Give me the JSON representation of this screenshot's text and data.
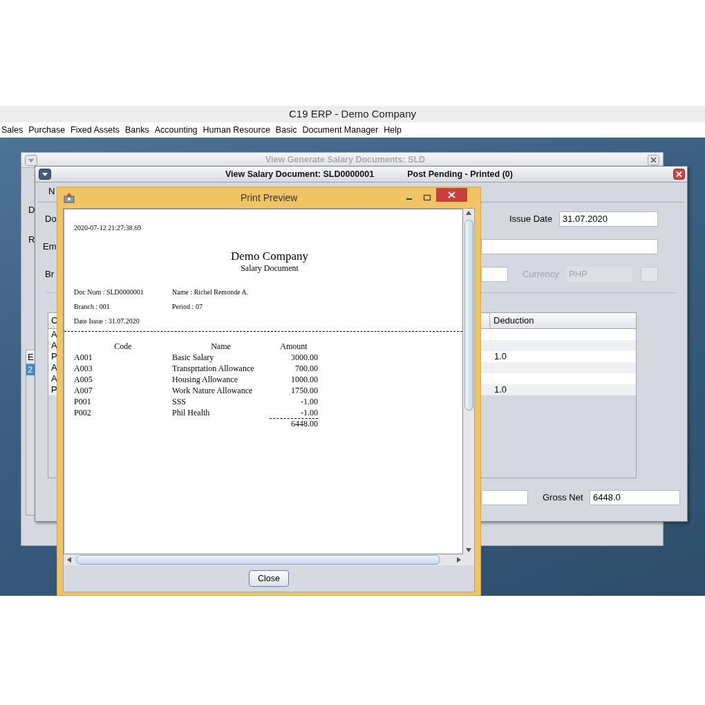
{
  "app": {
    "title": "C19 ERP - Demo Company"
  },
  "menu": [
    "Sales",
    "Purchase",
    "Fixed Assets",
    "Banks",
    "Accounting",
    "Human Resource",
    "Basic",
    "Document Manager",
    "Help"
  ],
  "back_window": {
    "title": "View Generate Salary Documents: SLD",
    "active": false,
    "labels": [
      "D",
      "R"
    ],
    "table": {
      "header": "E",
      "rows": [
        {
          "cell": "2",
          "selected": true
        }
      ]
    }
  },
  "salary_window": {
    "title": "View Salary Document: SLD0000001",
    "status": "Post Pending - Printed (0)",
    "active": true,
    "tab": "N",
    "labels": [
      "Do",
      "Em",
      "Br"
    ],
    "issue_date": {
      "label": "Issue Date",
      "value": "31.07.2020"
    },
    "currency": {
      "label": "Currency",
      "value": "PHP",
      "disabled": true
    },
    "table": {
      "columns": [
        "C",
        "Deduction"
      ],
      "rows": [
        {
          "column_1": "A"
        },
        {
          "column_1": "A"
        },
        {
          "column_1": "P",
          "deduction": "1.0"
        },
        {
          "column_1": "A"
        },
        {
          "column_1": "A"
        },
        {
          "column_1": "P",
          "deduction": "1.0"
        }
      ]
    },
    "gross_net": {
      "label": "Gross Net",
      "value": "6448.0"
    }
  },
  "print_preview": {
    "title": "Print Preview",
    "document": {
      "timestamp": "2020-07-12 21:27:38.69",
      "company": "Demo Company",
      "subtitle": "Salary Document",
      "fields": [
        [
          "Doc Num : SLD0000001",
          "Name : Richel Remonde A."
        ],
        [
          "Branch : 001",
          "Period : 07"
        ],
        [
          "Date Issue : 31.07.2020"
        ]
      ],
      "columns": [
        "Code",
        "Name",
        "Amount"
      ],
      "rows": [
        {
          "code": "A001",
          "name": "Basic Salary",
          "amount": "3000.00"
        },
        {
          "code": "A003",
          "name": "Transprtation Allowance",
          "amount": "700.00"
        },
        {
          "code": "A005",
          "name": "Housing Allowance",
          "amount": "1000.00"
        },
        {
          "code": "A007",
          "name": "Work Nature Allowance",
          "amount": "1750.00"
        },
        {
          "code": "P001",
          "name": "SSS",
          "amount": "-1.00"
        },
        {
          "code": "P002",
          "name": "Phil Health",
          "amount": "-1.00"
        }
      ],
      "total": "6448.00"
    },
    "close_button": "Close"
  }
}
